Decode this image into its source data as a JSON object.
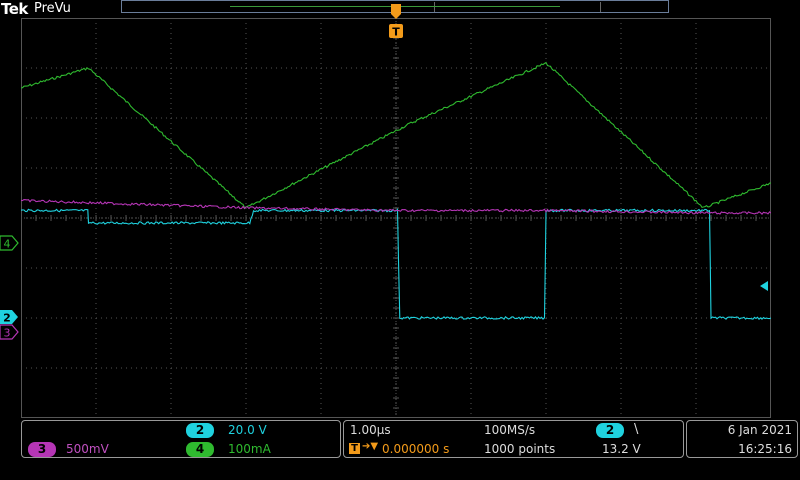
{
  "header": {
    "logo": "Tek",
    "acquisition_mode": "PreVu"
  },
  "markers": {
    "trigger_position_label": "T",
    "ch4_label": "4",
    "ch2_label": "2",
    "ch3_label": "3"
  },
  "colors": {
    "ch2": "#1fd2df",
    "ch3": "#b535b5",
    "ch4": "#2fba2f",
    "trigger": "#f39b1a",
    "graticule": "#555555"
  },
  "channels_panel": {
    "ch2": {
      "number": "2",
      "scale": "20.0 V"
    },
    "ch3": {
      "number": "3",
      "scale": "500mV"
    },
    "ch4": {
      "number": "4",
      "scale": "100mA"
    }
  },
  "timebase_panel": {
    "time_per_div": "1.00µs",
    "sample_rate": "100MS/s",
    "trigger_icon": "T",
    "horizontal_position": "0.000000 s",
    "record_length": "1000 points",
    "trigger_source": "2",
    "trigger_slope": "\\",
    "trigger_level": "13.2 V"
  },
  "datetime_panel": {
    "date": "6 Jan  2021",
    "time": "16:25:16"
  },
  "chart_data": {
    "type": "line",
    "x_unit": "div",
    "y_unit": "div",
    "xlim": [
      0,
      10
    ],
    "ylim": [
      -4,
      4
    ],
    "grid": true,
    "series": [
      {
        "channel": "4",
        "color": "#2fba2f",
        "x": [
          0,
          0.9,
          3.0,
          5.2,
          7.0,
          9.1,
          10
        ],
        "y": [
          2.6,
          3.0,
          0.2,
          1.9,
          3.1,
          0.2,
          0.7
        ]
      },
      {
        "channel": "2",
        "color": "#1fd2df",
        "x": [
          0,
          0.89,
          0.9,
          3.05,
          3.1,
          5.02,
          5.05,
          5.1,
          6.98,
          7.0,
          9.18,
          9.2,
          10
        ],
        "y": [
          0.15,
          0.15,
          -0.1,
          -0.1,
          0.15,
          0.15,
          -2.0,
          -2.0,
          -2.0,
          0.15,
          0.15,
          -2.0,
          -2.0
        ]
      },
      {
        "channel": "3",
        "color": "#b535b5",
        "x": [
          0,
          3.1,
          5.0,
          7.0,
          9.2,
          10
        ],
        "y": [
          0.35,
          0.2,
          0.15,
          0.15,
          0.1,
          0.1
        ]
      }
    ]
  }
}
